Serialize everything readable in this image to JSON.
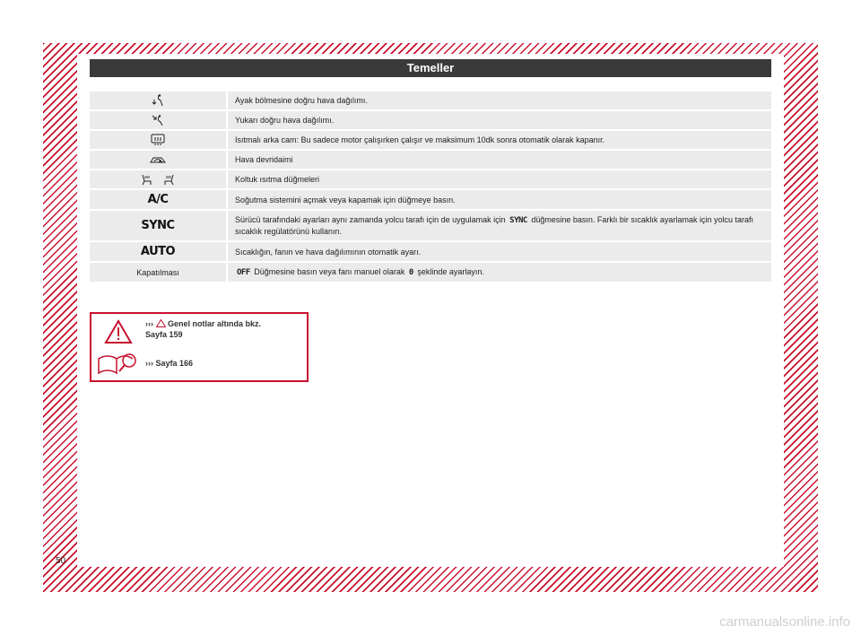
{
  "header": {
    "title": "Temeller"
  },
  "rows": [
    {
      "icon": "floor-air-icon",
      "mark": "",
      "desc": "Ayak bölmesine doğru hava dağılımı."
    },
    {
      "icon": "upper-air-icon",
      "mark": "",
      "desc": "Yukarı doğru hava dağılımı."
    },
    {
      "icon": "rear-defrost-icon",
      "mark": "",
      "desc": "Isıtmalı arka cam: Bu sadece motor çalışırken çalışır ve maksimum 10dk sonra otomatik olarak kapanır."
    },
    {
      "icon": "recirculation-icon",
      "mark": "",
      "desc": "Hava devridaimi"
    },
    {
      "icon": "seat-heating-icon",
      "mark": "",
      "desc": "Koltuk ısıtma düğmeleri"
    },
    {
      "icon": "",
      "mark": "A/C",
      "desc": "Soğutma sistemini açmak veya kapamak için düğmeye basın."
    },
    {
      "icon": "",
      "mark": "SYNC",
      "desc_before": "Sürücü tarafındaki ayarları aynı zamanda yolcu tarafı için de uygulamak için",
      "desc_mark": "SYNC",
      "desc_after": "düğmesine basın. Farklı bir sıcaklık ayarlamak için yolcu tarafı sıcaklık regülatörünü kullanın."
    },
    {
      "icon": "",
      "mark": "AUTO",
      "desc": "Sıcaklığın, fanın ve hava dağılımının otomatik ayarı."
    },
    {
      "icon": "",
      "mark": "Kapatılması",
      "desc_mark": "OFF",
      "desc_before": "Düğmesine basın veya fanı manuel olarak",
      "desc_mark2": "0",
      "desc_after": "şeklinde ayarlayın."
    }
  ],
  "notes": {
    "warning_prefix": "›››",
    "warning_text": "Genel notlar altında bkz.",
    "warning_page": "Sayfa 159",
    "book_prefix": "›››",
    "book_text": "Sayfa 166"
  },
  "page_number": "50",
  "watermark": "carmanualsonline.info"
}
